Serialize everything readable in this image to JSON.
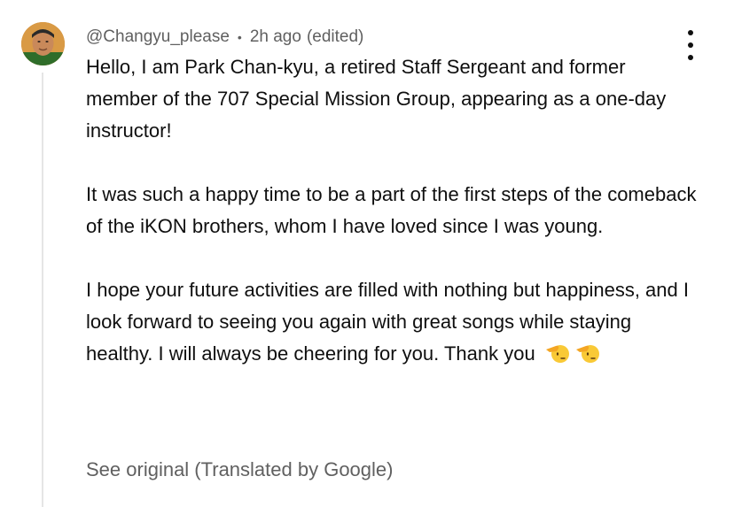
{
  "comment": {
    "author": "@Changyu_please",
    "separator": "•",
    "time": "2h ago",
    "edited": "(edited)",
    "paragraphs": [
      "Hello, I am Park Chan-kyu, a retired Staff Sergeant and former member of the 707 Special Mission Group, appearing as a one-day instructor!",
      "It was such a happy time to be a part of the first steps of the comeback of the iKON brothers, whom I have loved since I was young.",
      "I hope your future activities are filled with nothing but happiness, and I look forward to seeing you again with great songs while staying healthy. I will always be cheering for you. Thank you"
    ],
    "emoji": [
      "saluting-face",
      "saluting-face"
    ],
    "translation_link": "See original (Translated by Google)"
  },
  "icons": {
    "more": "vertical-ellipsis-icon",
    "avatar": "user-avatar"
  },
  "colors": {
    "text": "#0f0f0f",
    "secondary_text": "#606060",
    "thread_line": "#e5e5e5",
    "emoji_yellow": "#f9c936",
    "hand_yellow": "#f4a623"
  }
}
